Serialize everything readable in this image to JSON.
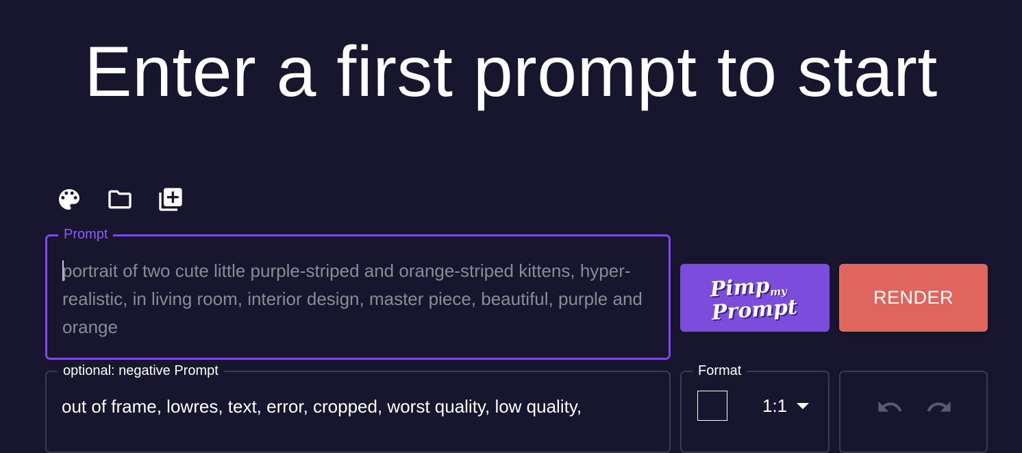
{
  "heading": "Enter a first prompt to start",
  "toolbar": {
    "icons": [
      "palette-icon",
      "folder-icon",
      "add-to-library-icon"
    ]
  },
  "prompt": {
    "label": "Prompt",
    "placeholder": "portrait of two cute little purple-striped and orange-striped kittens, hyper-realistic, in living room,  interior design, master piece, beautiful, purple and orange"
  },
  "negative_prompt": {
    "label": "optional: negative Prompt",
    "value": "out of frame, lowres, text, error, cropped, worst quality, low quality,"
  },
  "pimp_button": {
    "line1": "Pimp",
    "line1_small": "my",
    "line2": "Prompt"
  },
  "render_button": {
    "label": "RENDER"
  },
  "format": {
    "label": "Format",
    "selected": "1:1"
  },
  "history": {
    "icons": [
      "undo-icon",
      "redo-icon"
    ]
  },
  "colors": {
    "background": "#17162e",
    "accent_purple": "#7c4ddc",
    "render_red": "#e0655c",
    "border_gray": "#3b3a55",
    "placeholder_gray": "#8b8a97"
  }
}
